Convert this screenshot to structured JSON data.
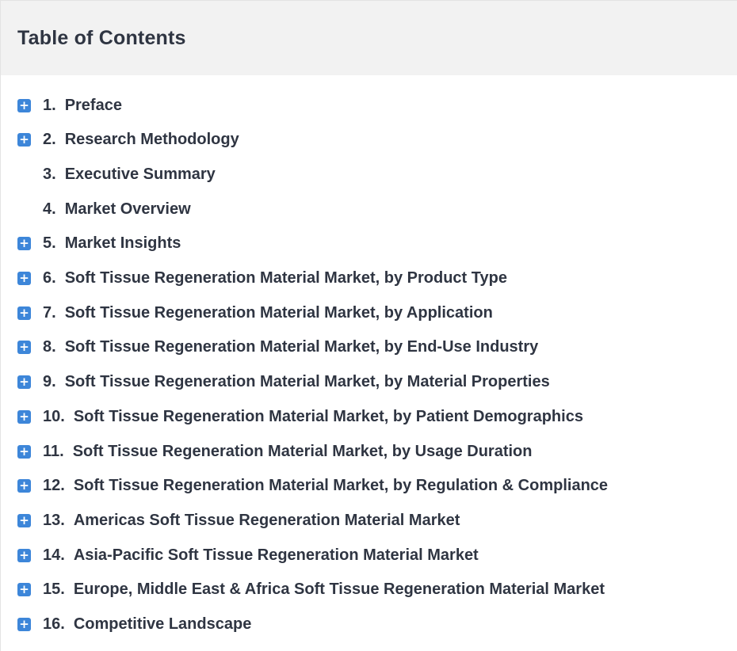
{
  "toc": {
    "title": "Table of Contents",
    "expand_icon_glyph": "+",
    "items": [
      {
        "num": "1.",
        "label": "Preface",
        "expandable": true
      },
      {
        "num": "2.",
        "label": "Research Methodology",
        "expandable": true
      },
      {
        "num": "3.",
        "label": "Executive Summary",
        "expandable": false
      },
      {
        "num": "4.",
        "label": "Market Overview",
        "expandable": false
      },
      {
        "num": "5.",
        "label": "Market Insights",
        "expandable": true
      },
      {
        "num": "6.",
        "label": "Soft Tissue Regeneration Material Market, by Product Type",
        "expandable": true
      },
      {
        "num": "7.",
        "label": "Soft Tissue Regeneration Material Market, by Application",
        "expandable": true
      },
      {
        "num": "8.",
        "label": "Soft Tissue Regeneration Material Market, by End-Use Industry",
        "expandable": true
      },
      {
        "num": "9.",
        "label": "Soft Tissue Regeneration Material Market, by Material Properties",
        "expandable": true
      },
      {
        "num": "10.",
        "label": "Soft Tissue Regeneration Material Market, by Patient Demographics",
        "expandable": true
      },
      {
        "num": "11.",
        "label": "Soft Tissue Regeneration Material Market, by Usage Duration",
        "expandable": true
      },
      {
        "num": "12.",
        "label": "Soft Tissue Regeneration Material Market, by Regulation & Compliance",
        "expandable": true
      },
      {
        "num": "13.",
        "label": "Americas Soft Tissue Regeneration Material Market",
        "expandable": true
      },
      {
        "num": "14.",
        "label": "Asia-Pacific Soft Tissue Regeneration Material Market",
        "expandable": true
      },
      {
        "num": "15.",
        "label": "Europe, Middle East & Africa Soft Tissue Regeneration Material Market",
        "expandable": true
      },
      {
        "num": "16.",
        "label": "Competitive Landscape",
        "expandable": true
      }
    ]
  },
  "colors": {
    "accent": "#3d86d9",
    "text": "#2f3542",
    "header_bg": "#f2f2f2"
  }
}
